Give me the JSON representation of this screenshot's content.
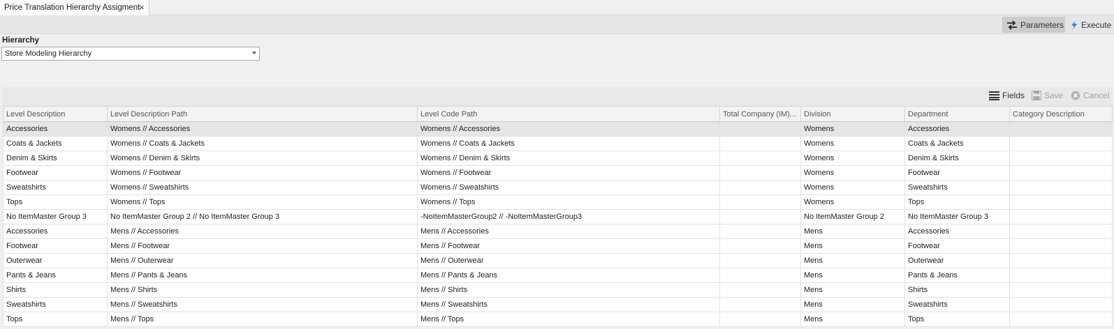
{
  "tab": {
    "title": "Price Translation Hierarchy Assigment",
    "close_glyph": "×"
  },
  "toolbar": {
    "parameters_label": "Parameters",
    "execute_label": "Execute"
  },
  "hierarchy": {
    "label": "Hierarchy",
    "selected": "Store Modeling Hierarchy"
  },
  "grid_toolbar": {
    "fields_label": "Fields",
    "save_label": "Save",
    "cancel_label": "Cancel"
  },
  "table": {
    "columns": [
      "Level Description",
      "Level Description Path",
      "Level Code Path",
      "Total Company (IM)...",
      "Division",
      "Department",
      "Category Description"
    ],
    "rows": [
      [
        "Accessories",
        "Womens // Accessories",
        "Womens // Accessories",
        "",
        "Womens",
        "Accessories",
        ""
      ],
      [
        "Coats & Jackets",
        "Womens // Coats & Jackets",
        "Womens // Coats & Jackets",
        "",
        "Womens",
        "Coats & Jackets",
        ""
      ],
      [
        "Denim & Skirts",
        "Womens // Denim & Skirts",
        "Womens // Denim & Skirts",
        "",
        "Womens",
        "Denim & Skirts",
        ""
      ],
      [
        "Footwear",
        "Womens // Footwear",
        "Womens // Footwear",
        "",
        "Womens",
        "Footwear",
        ""
      ],
      [
        "Sweatshirts",
        "Womens // Sweatshirts",
        "Womens // Sweatshirts",
        "",
        "Womens",
        "Sweatshirts",
        ""
      ],
      [
        "Tops",
        "Womens // Tops",
        "Womens // Tops",
        "",
        "Womens",
        "Tops",
        ""
      ],
      [
        "No ItemMaster Group 3",
        "No ItemMaster Group 2 // No ItemMaster Group 3",
        "-NoItemMasterGroup2 // -NoItemMasterGroup3",
        "",
        "No ItemMaster Group 2",
        "No ItemMaster Group 3",
        ""
      ],
      [
        "Accessories",
        "Mens // Accessories",
        "Mens // Accessories",
        "",
        "Mens",
        "Accessories",
        ""
      ],
      [
        "Footwear",
        "Mens // Footwear",
        "Mens // Footwear",
        "",
        "Mens",
        "Footwear",
        ""
      ],
      [
        "Outerwear",
        "Mens // Outerwear",
        "Mens // Outerwear",
        "",
        "Mens",
        "Outerwear",
        ""
      ],
      [
        "Pants & Jeans",
        "Mens // Pants & Jeans",
        "Mens // Pants & Jeans",
        "",
        "Mens",
        "Pants & Jeans",
        ""
      ],
      [
        "Shirts",
        "Mens // Shirts",
        "Mens // Shirts",
        "",
        "Mens",
        "Shirts",
        ""
      ],
      [
        "Sweatshirts",
        "Mens // Sweatshirts",
        "Mens // Sweatshirts",
        "",
        "Mens",
        "Sweatshirts",
        ""
      ],
      [
        "Tops",
        "Mens // Tops",
        "Mens // Tops",
        "",
        "Mens",
        "Tops",
        ""
      ]
    ],
    "selected_row": 0
  },
  "colors": {
    "selected_row": "#e6e6e6",
    "params_active_bg": "#cccccc",
    "execute_icon": "#2e7fd6",
    "disabled_text": "#a0a0a0"
  },
  "icons": {
    "parameters": "swap-arrows-icon",
    "execute": "lightning-icon",
    "fields": "list-lines-icon",
    "save": "floppy-disk-icon",
    "cancel": "x-circle-icon",
    "dropdown": "chevron-down-icon"
  }
}
